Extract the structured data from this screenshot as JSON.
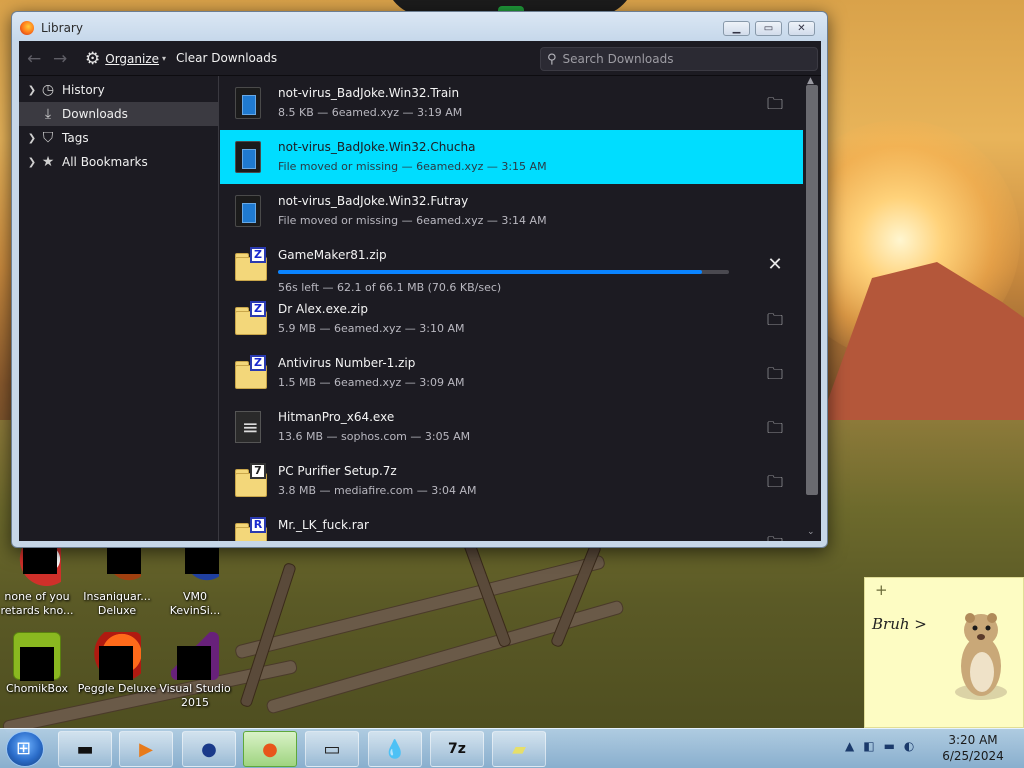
{
  "window": {
    "title": "Library"
  },
  "toolbar": {
    "organize_label": "Organize",
    "clear_label": "Clear Downloads",
    "search_placeholder": "Search Downloads"
  },
  "sidebar": {
    "items": [
      {
        "label": "History",
        "icon": "clock-icon",
        "expandable": true
      },
      {
        "label": "Downloads",
        "icon": "download-icon",
        "expandable": false,
        "selected": true
      },
      {
        "label": "Tags",
        "icon": "tag-icon",
        "expandable": true
      },
      {
        "label": "All Bookmarks",
        "icon": "star-icon",
        "expandable": true
      }
    ]
  },
  "downloads": [
    {
      "name": "not-virus_BadJoke.Win32.Train",
      "meta": "8.5 KB — 6eamed.xyz — 3:19 AM",
      "icon": "exe-icon",
      "action": "open-folder"
    },
    {
      "name": "not-virus_BadJoke.Win32.Chucha",
      "meta": "File moved or missing — 6eamed.xyz — 3:15 AM",
      "icon": "exe-icon",
      "selected": true
    },
    {
      "name": "not-virus_BadJoke.Win32.Futray",
      "meta": "File moved or missing — 6eamed.xyz — 3:14 AM",
      "icon": "exe-icon"
    },
    {
      "name": "GameMaker81.zip",
      "meta": "56s left — 62.1 of 66.1 MB (70.6 KB/sec)",
      "icon": "zip-icon",
      "letter": "Z",
      "downloading": true,
      "progress": 0.94,
      "action": "cancel"
    },
    {
      "name": "Dr Alex.exe.zip",
      "meta": "5.9 MB — 6eamed.xyz — 3:10 AM",
      "icon": "zip-icon",
      "letter": "Z",
      "action": "open-folder"
    },
    {
      "name": "Antivirus Number-1.zip",
      "meta": "1.5 MB — 6eamed.xyz — 3:09 AM",
      "icon": "zip-icon",
      "letter": "Z",
      "action": "open-folder"
    },
    {
      "name": "HitmanPro_x64.exe",
      "meta": "13.6 MB — sophos.com — 3:05 AM",
      "icon": "hitmanpro-icon",
      "action": "open-folder"
    },
    {
      "name": "PC Purifier Setup.7z",
      "meta": "3.8 MB — mediafire.com — 3:04 AM",
      "icon": "7z-icon",
      "letter": "7",
      "action": "open-folder"
    },
    {
      "name": "Mr._LK_fuck.rar",
      "meta": "",
      "icon": "rar-icon",
      "letter": "R",
      "action": "open-folder"
    }
  ],
  "desktop": {
    "icons": [
      {
        "label": "none of you\nretards kno...",
        "icon": "app-icon"
      },
      {
        "label": "Insaniquar...\nDeluxe",
        "icon": "game-icon"
      },
      {
        "label": "VM0\nKevinSi...",
        "icon": "app-icon"
      },
      {
        "label": "ChomikBox",
        "icon": "chomikbox-icon"
      },
      {
        "label": "Peggle Deluxe",
        "icon": "peggle-icon"
      },
      {
        "label": "Visual Studio\n2015",
        "icon": "visual-studio-icon"
      }
    ]
  },
  "sticky_note": {
    "text": "Bruh >"
  },
  "taskbar": {
    "time": "3:20 AM",
    "date": "6/25/2024",
    "apps": [
      "terminal-icon",
      "media-player-icon",
      "globe-icon",
      "firefox-icon",
      "monitor-icon",
      "water-drop-icon",
      "7zip-icon",
      "sticky-notes-icon"
    ]
  },
  "colors": {
    "selection": "#00ddff",
    "progress": "#0a84ff",
    "panel_bg": "#1c1b22"
  }
}
